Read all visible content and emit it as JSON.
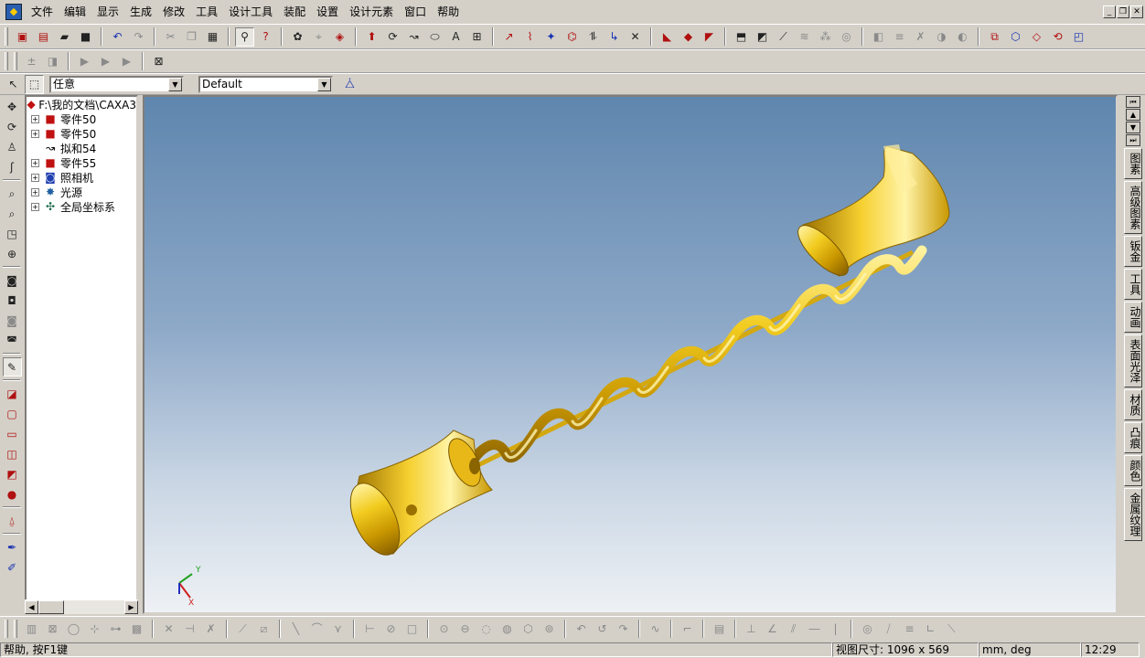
{
  "app": {
    "icon": "caxa-app-icon"
  },
  "menu": [
    "文件",
    "编辑",
    "显示",
    "生成",
    "修改",
    "工具",
    "设计工具",
    "装配",
    "设置",
    "设计元素",
    "窗口",
    "帮助"
  ],
  "window_controls": {
    "minimize": "_",
    "restore": "❐",
    "close": "✕"
  },
  "filter_combo": {
    "value": "任意"
  },
  "config_combo": {
    "value": "Default"
  },
  "tree": {
    "root": "F:\\我的文档\\CAXA3",
    "items": [
      {
        "label": "零件50",
        "icon": "part-icon",
        "expandable": true
      },
      {
        "label": "零件50",
        "icon": "part-icon",
        "expandable": true
      },
      {
        "label": "拟和54",
        "icon": "curve-icon",
        "expandable": false
      },
      {
        "label": "零件55",
        "icon": "part-icon",
        "expandable": true
      },
      {
        "label": "照相机",
        "icon": "camera-icon",
        "expandable": true
      },
      {
        "label": "光源",
        "icon": "light-icon",
        "expandable": true
      },
      {
        "label": "全局坐标系",
        "icon": "coordinate-system-icon",
        "expandable": true
      }
    ]
  },
  "viewport": {
    "axis_y": "Y",
    "axis_x": "X",
    "model_color": "#e8c020"
  },
  "right_tabs": [
    "图素",
    "高级图素",
    "钣金",
    "工具",
    "动画",
    "表面光泽",
    "材质",
    "凸痕",
    "颜色",
    "金属纹理"
  ],
  "status": {
    "help": "帮助, 按F1键",
    "view_size": "视图尺寸: 1096 x  569",
    "units": "mm, deg",
    "time": "12:29"
  }
}
